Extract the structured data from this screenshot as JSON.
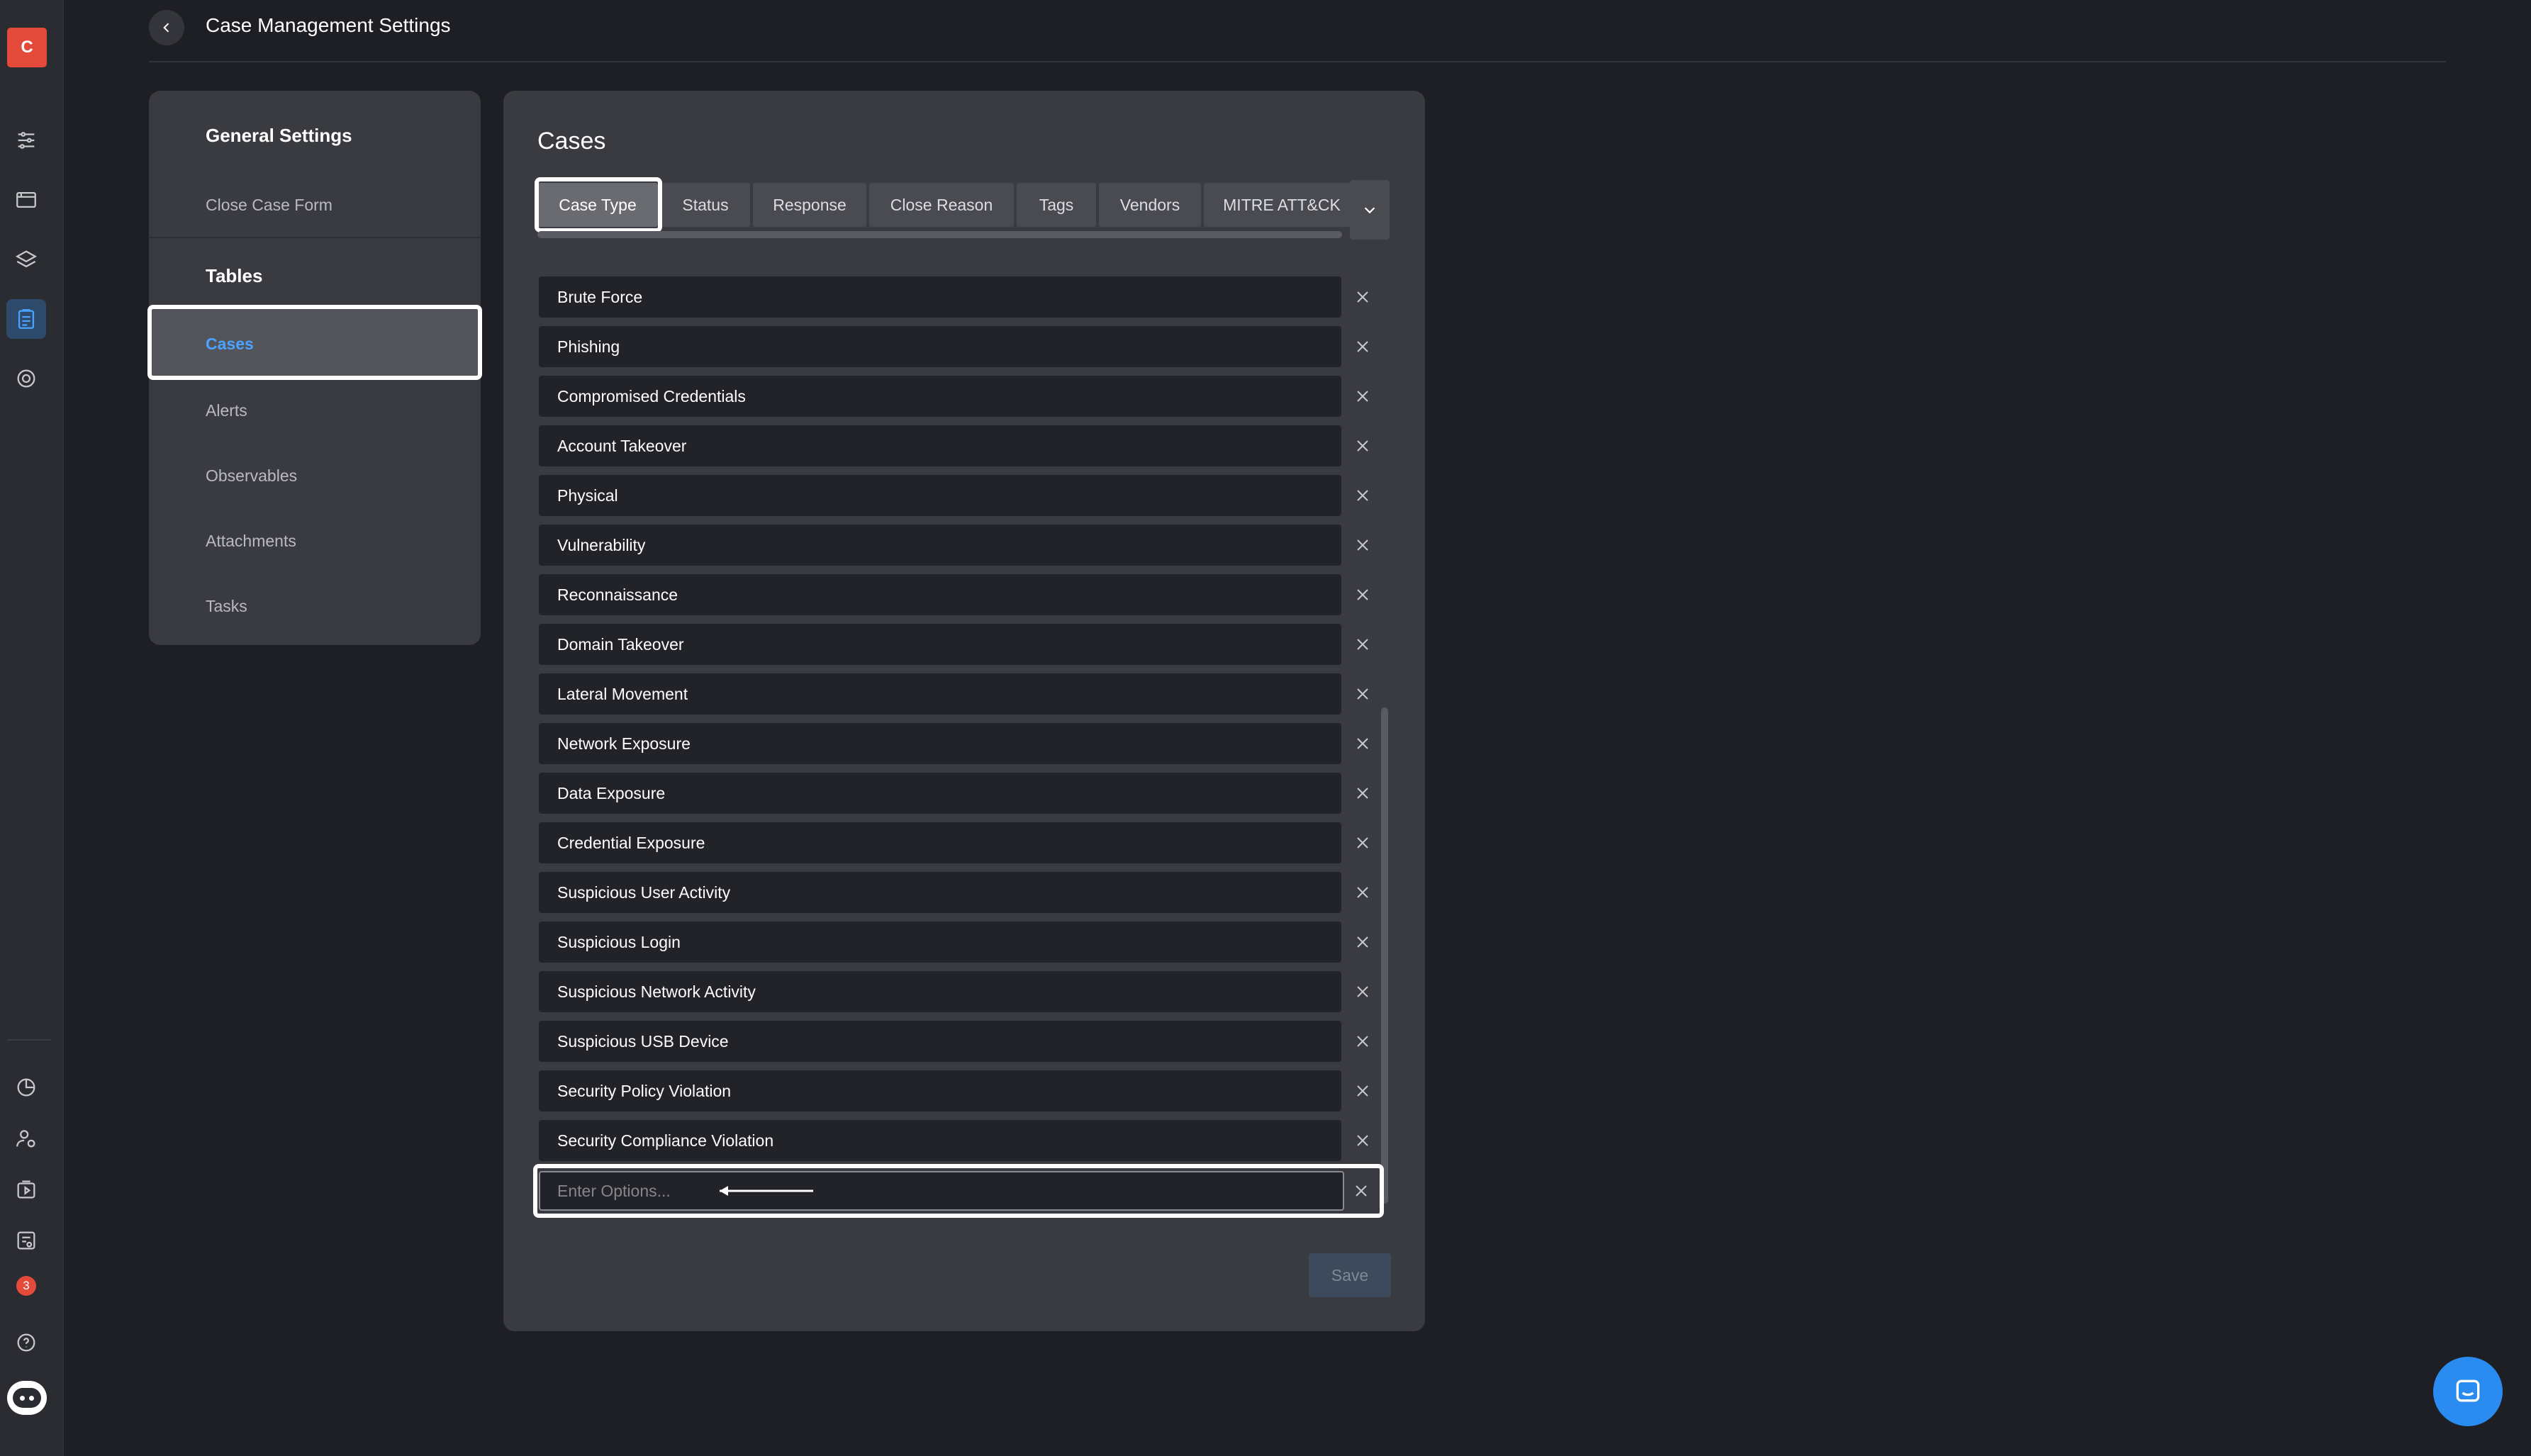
{
  "header": {
    "title": "Case Management Settings"
  },
  "rail": {
    "logo_letter": "C",
    "notification_count": "3"
  },
  "nav": {
    "general_settings": "General Settings",
    "close_case_form": "Close Case Form",
    "tables": "Tables",
    "cases": "Cases",
    "alerts": "Alerts",
    "observables": "Observables",
    "attachments": "Attachments",
    "tasks": "Tasks"
  },
  "card": {
    "title": "Cases",
    "tabs": [
      {
        "label": "Case Type"
      },
      {
        "label": "Status"
      },
      {
        "label": "Response"
      },
      {
        "label": "Close Reason"
      },
      {
        "label": "Tags"
      },
      {
        "label": "Vendors"
      },
      {
        "label": "MITRE ATT&CK"
      }
    ],
    "options": [
      "Brute Force",
      "Phishing",
      "Compromised Credentials",
      "Account Takeover",
      "Physical",
      "Vulnerability",
      "Reconnaissance",
      "Domain Takeover",
      "Lateral Movement",
      "Network Exposure",
      "Data Exposure",
      "Credential Exposure",
      "Suspicious User Activity",
      "Suspicious Login",
      "Suspicious Network Activity",
      "Suspicious USB Device",
      "Security Policy Violation",
      "Security Compliance Violation"
    ],
    "input": {
      "placeholder": "Enter Options...",
      "value": ""
    },
    "save_label": "Save"
  }
}
